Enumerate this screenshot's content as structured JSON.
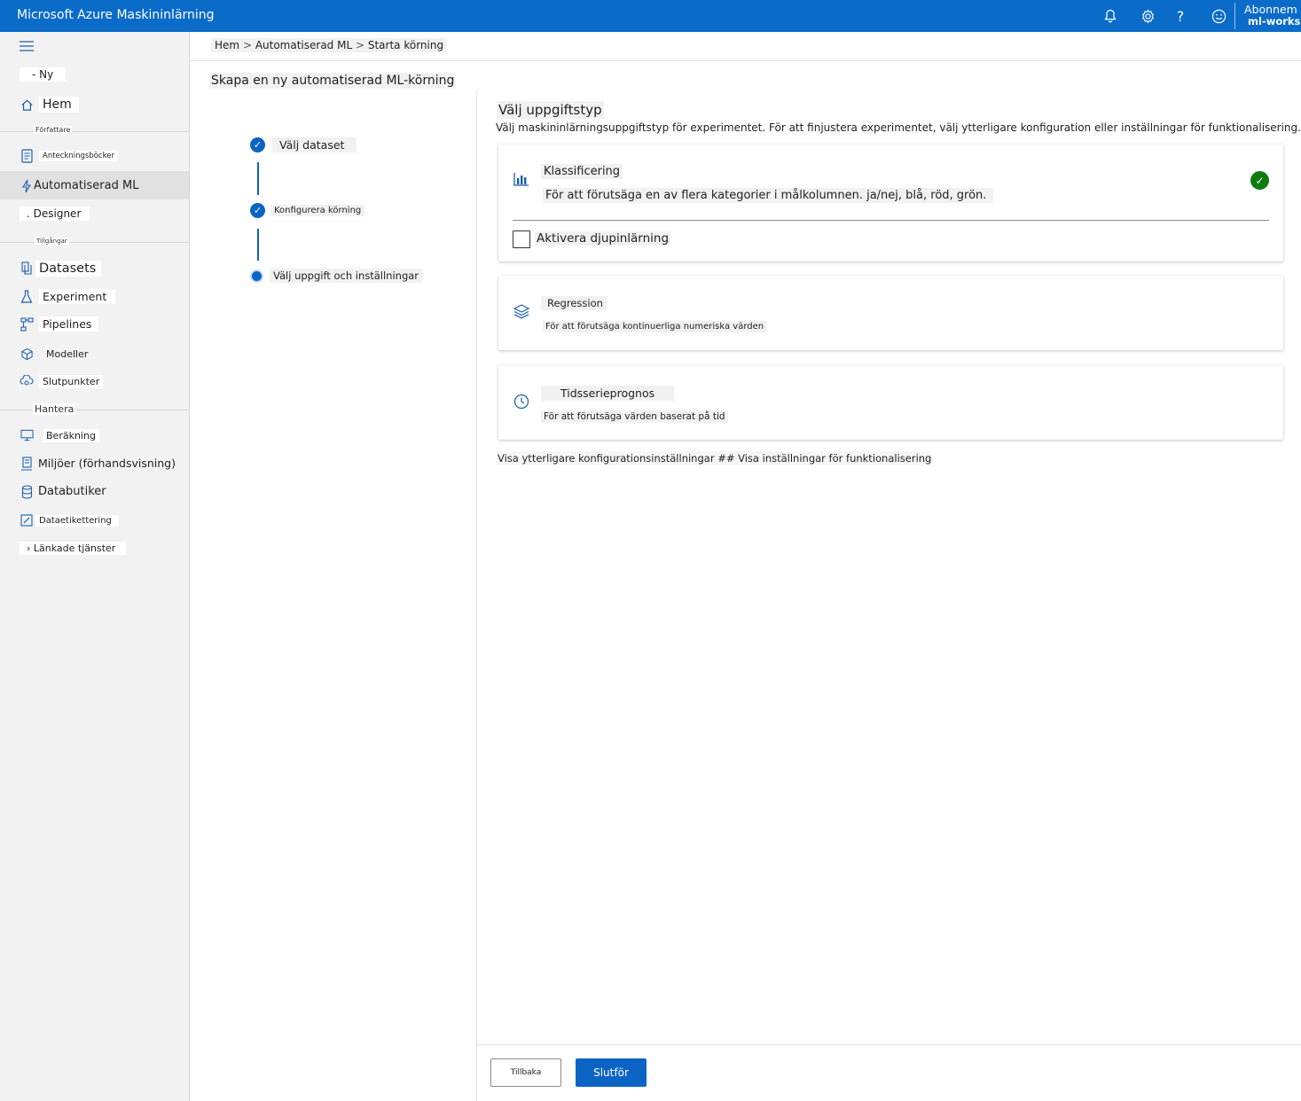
{
  "app": {
    "title": "Microsoft Azure Maskininlärning"
  },
  "topbar": {
    "icons": [
      "bell-icon",
      "gear-icon",
      "help-icon",
      "smiley-icon"
    ],
    "account_line1": "Abonnem",
    "account_line2": "ml-worksp"
  },
  "sidebar": {
    "new_label": "- Ny",
    "home_label": "Hem",
    "section_author": "Författare",
    "notebooks_label": "Anteckningsböcker",
    "automl_label": "Automatiserad ML",
    "designer_label": ". Designer",
    "section_assets": "Tillgångar",
    "datasets_label": "Datasets",
    "experiments_label": "Experiment",
    "pipelines_label": "Pipelines",
    "models_label": "Modeller",
    "endpoints_label": "Slutpunkter",
    "section_manage": "Hantera",
    "compute_label": "Beräkning",
    "environments_label": "Miljöer (förhandsvisning)",
    "datastores_label": "Databutiker",
    "labeling_label": "Dataetikettering",
    "linked_label": "› Länkade tjänster"
  },
  "breadcrumb": {
    "home": "Hem",
    "automl": "Automatiserad ML",
    "current": "Starta körning"
  },
  "page": {
    "title": "Skapa en ny automatiserad ML-körning"
  },
  "steps": [
    {
      "label": "Välj dataset",
      "status": "done"
    },
    {
      "label": "Konfigurera körning",
      "status": "done"
    },
    {
      "label": "Välj uppgift och inställningar",
      "status": "current"
    }
  ],
  "task": {
    "title": "Välj uppgiftstyp",
    "description": "Välj maskininlärningsuppgiftstyp för experimentet. För att finjustera experimentet, välj ytterligare konfiguration eller inställningar för funktionalisering.",
    "options": [
      {
        "name": "Klassificering",
        "description": "För att förutsäga en av flera kategorier i målkolumnen. ja/nej, blå, röd, grön.",
        "selected": true
      },
      {
        "name": "Regression",
        "description": "För att förutsäga kontinuerliga numeriska värden",
        "selected": false
      },
      {
        "name": "Tidsserieprognos",
        "description": "För att förutsäga värden baserat på tid",
        "selected": false
      }
    ],
    "deep_learning_label": "Aktivera djupinlärning",
    "more_settings": "Visa ytterligare konfigurationsinställningar ## Visa inställningar för funktionalisering"
  },
  "footer": {
    "back_label": "Tillbaka",
    "finish_label": "Slutför"
  },
  "colors": {
    "topbar": "#0a6bc9",
    "accent": "#0b64c4",
    "success": "#107c10"
  }
}
